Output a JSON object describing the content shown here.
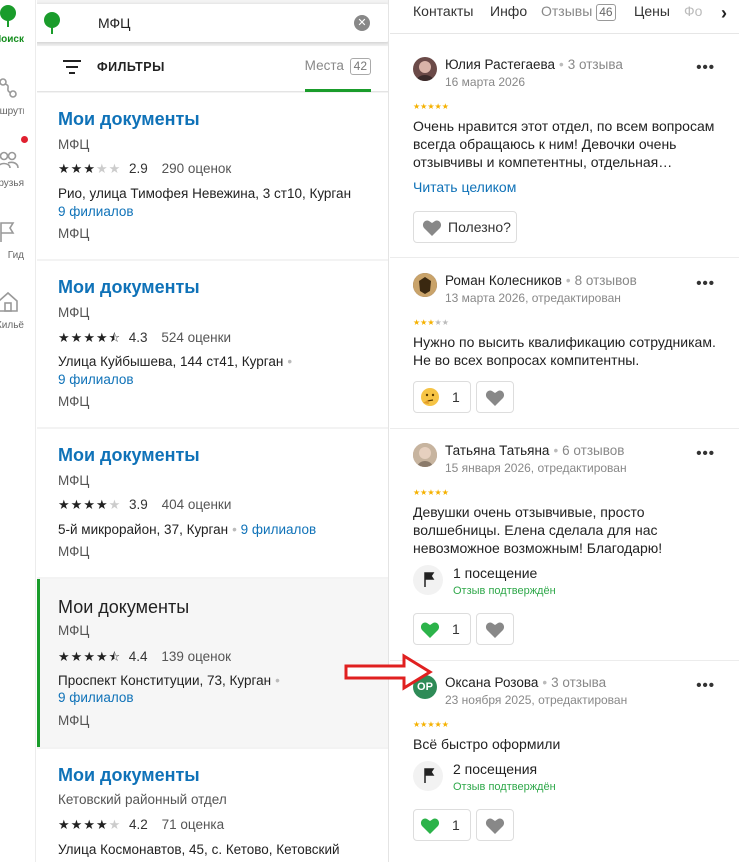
{
  "nav": {
    "items": [
      {
        "label": "Поиск"
      },
      {
        "label": "Маршруты"
      },
      {
        "label": "Друзья"
      },
      {
        "label": "Гид"
      },
      {
        "label": "Жильё"
      }
    ]
  },
  "search": {
    "value": "МФЦ"
  },
  "filters": {
    "label": "ФИЛЬТРЫ",
    "places_label": "Места",
    "places_count": "42"
  },
  "cards": [
    {
      "title": "Мои документы",
      "category": "МФЦ",
      "stars": 3,
      "rating": "2.9",
      "count": "290 оценок",
      "address": "Рио, улица Тимофея Невежина, 3 ст10, Курган",
      "branches": "9 филиалов",
      "category2": "МФЦ"
    },
    {
      "title": "Мои документы",
      "category": "МФЦ",
      "stars": 4.5,
      "rating": "4.3",
      "count": "524 оценки",
      "address": "Улица Куйбышева, 144 ст41, Курган",
      "branches": "9 филиалов",
      "category2": "МФЦ"
    },
    {
      "title": "Мои документы",
      "category": "МФЦ",
      "stars": 4,
      "rating": "3.9",
      "count": "404 оценки",
      "address": "5-й микрорайон, 37, Курган",
      "branches": "9 филиалов",
      "category2": "МФЦ"
    },
    {
      "title": "Мои документы",
      "category": "МФЦ",
      "stars": 4.5,
      "rating": "4.4",
      "count": "139 оценок",
      "address": "Проспект Конституции, 73, Курган",
      "branches": "9 филиалов",
      "category2": "МФЦ"
    },
    {
      "title": "Мои документы",
      "category": "Кетовский районный отдел",
      "stars": 4,
      "rating": "4.2",
      "count": "71 оценка",
      "address": "Улица Космонавтов, 45, с. Кетово, Кетовский"
    }
  ],
  "tabs": [
    {
      "label": "Контакты"
    },
    {
      "label": "Инфо"
    },
    {
      "label": "Отзывы",
      "count": "46"
    },
    {
      "label": "Цены"
    },
    {
      "label": "Фо"
    }
  ],
  "tabs_arrow": "›",
  "reviews": [
    {
      "name": "Юлия Растегаева",
      "reviews_count": "3 отзыва",
      "date": "16 марта 2026",
      "stars": 5,
      "text": "Очень нравится этот отдел, по всем вопросам всегда обращаюсь к ним! Девочки очень отзывчивы и компетентны, отдельная…",
      "read_more": "Читать целиком",
      "useful_label": "Полезно?"
    },
    {
      "name": "Роман Колесников",
      "reviews_count": "8 отзывов",
      "date": "13 марта 2026, отредактирован",
      "stars": 3,
      "text": "Нужно по высить квалификацию сотрудникам. Не во всех вопросах компитентны.",
      "reaction_count": "1"
    },
    {
      "name": "Татьяна Татьяна",
      "reviews_count": "6 отзывов",
      "date": "15 января 2026, отредактирован",
      "stars": 5,
      "text": "Девушки очень отзывчивые, просто волшебницы. Елена сделала для нас невозможное возможным! Благодарю!",
      "visits": "1 посещение",
      "confirmed": "Отзыв подтверждён",
      "reaction_count": "1"
    },
    {
      "name": "Оксана Розова",
      "reviews_count": "3 отзыва",
      "date": "23 ноября 2025, отредактирован",
      "stars": 5,
      "initials": "ОР",
      "text": "Всё быстро оформили",
      "visits": "2 посещения",
      "confirmed": "Отзыв подтверждён",
      "reaction_count": "1"
    }
  ],
  "colors": {
    "brand_green": "#1a9c2b",
    "link_blue": "#0f72b8",
    "star_gold": "#f5b100",
    "annotation_red": "#e02020"
  }
}
